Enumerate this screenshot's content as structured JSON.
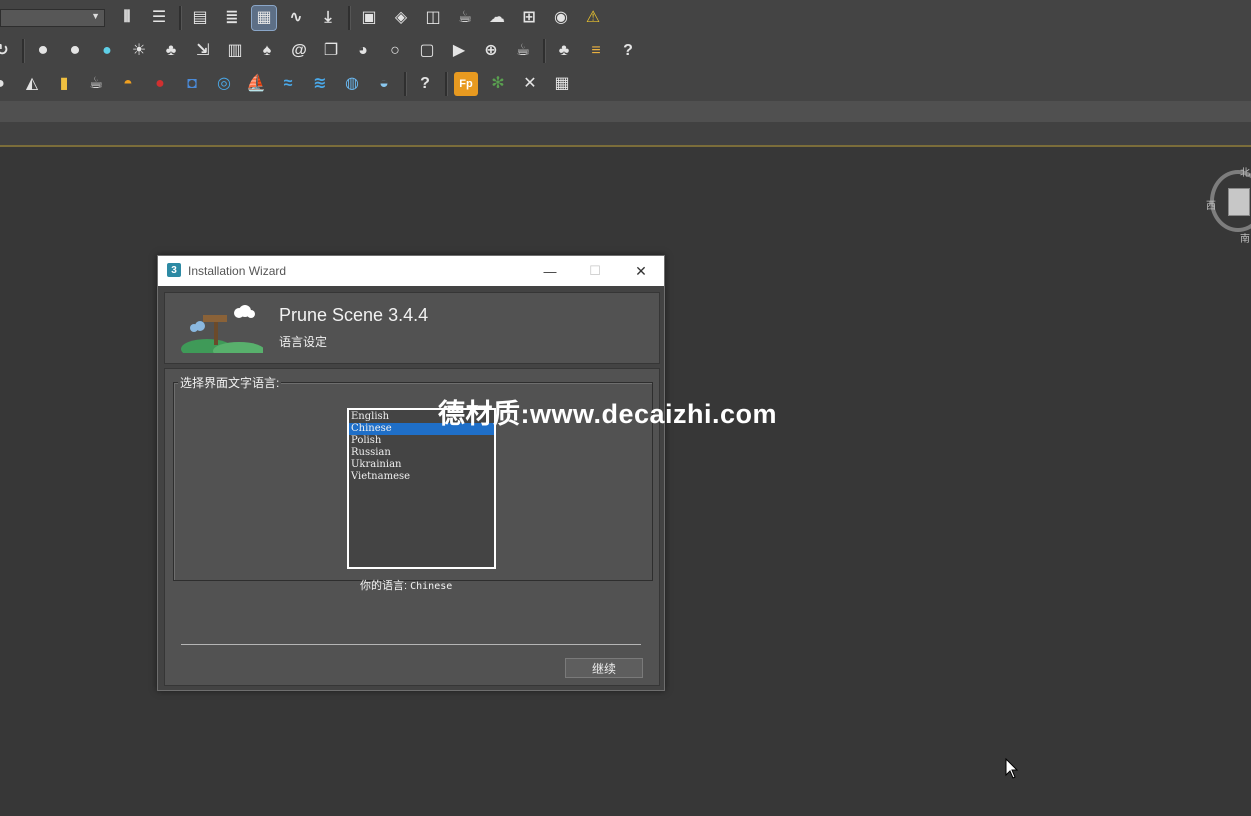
{
  "toolbar": {
    "combo_value": "",
    "row1_icons": [
      "mirror-icon",
      "align-icon",
      "scene-explorer-icon",
      "layer-explorer-icon",
      "ribbon-toggle-icon",
      "curve-editor-icon",
      "dope-sheet-icon",
      "render-setup-icon",
      "render-frame-icon",
      "material-editor-icon",
      "render-icon",
      "render-cloud-icon",
      "grid-icon",
      "autodesk-a360-icon",
      "warning-icon"
    ],
    "row2_icons": [
      "refresh-icon",
      "camera-icon",
      "camera-add-icon",
      "light-bulb-icon",
      "sun-icon",
      "tree-icon",
      "export-icon",
      "book-icon",
      "tree-export-icon",
      "spiral-icon",
      "copy-icon",
      "palette-icon",
      "bulb-icon",
      "panel-icon",
      "play-panel-icon",
      "target-icon",
      "teapot-icon",
      "forest-icon",
      "list-icon",
      "help-icon"
    ],
    "row3_icons": [
      "plugin-1-icon",
      "plugin-2-icon",
      "beer-icon",
      "coffee-icon",
      "island-icon",
      "red-ball-icon",
      "backpack-icon",
      "swirl-icon",
      "boat-icon",
      "wave-icon",
      "water-icon",
      "globe-icon",
      "lake-icon",
      "help-question-icon",
      "fp-icon",
      "plant-icon",
      "tools-icon",
      "table-icon"
    ]
  },
  "viewcube": {
    "north": "北",
    "west": "西",
    "south": "南"
  },
  "watermark": "德材质:www.decaizhi.com",
  "wizard": {
    "app_icon_label": "3",
    "window_title": "Installation Wizard",
    "minimize": "—",
    "maximize": "☐",
    "close": "✕",
    "app_name": "Prune Scene 3.4.4",
    "page_subtitle": "语言设定",
    "group_label": "选择界面文字语言:",
    "languages": [
      {
        "label": "English"
      },
      {
        "label": "Chinese",
        "selected": true
      },
      {
        "label": "Polish"
      },
      {
        "label": "Russian"
      },
      {
        "label": "Ukrainian"
      },
      {
        "label": "Vietnamese"
      }
    ],
    "current_label": "你的语言:",
    "current_value": "Chinese",
    "continue_label": "继续"
  },
  "colors": {
    "selection": "#1f6fc8",
    "dialog_bg": "#525252",
    "viewport_bg": "#373737",
    "accent_line": "#7b6d3a"
  }
}
